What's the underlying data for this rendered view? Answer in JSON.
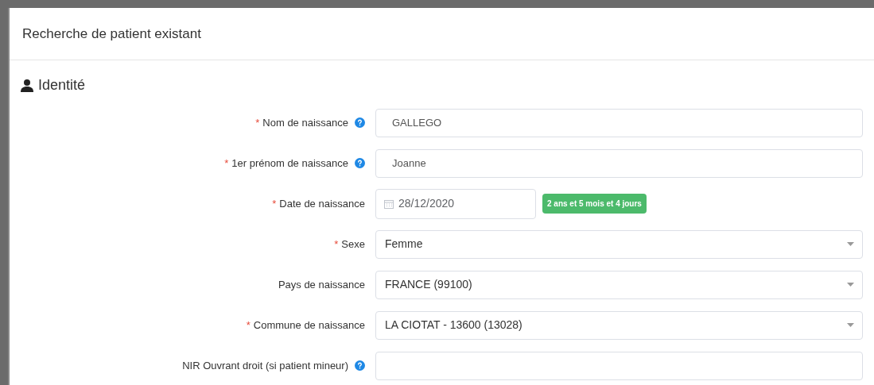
{
  "modal": {
    "title": "Recherche de patient existant"
  },
  "section": {
    "title": "Identité"
  },
  "fields": [
    {
      "kind": "text",
      "required_mark": "*",
      "label": "Nom de naissance",
      "help": true,
      "value": "GALLEGO"
    },
    {
      "kind": "text",
      "required_mark": "*",
      "label": "1er prénom de naissance",
      "help": true,
      "value": "Joanne"
    },
    {
      "kind": "date",
      "required_mark": "*",
      "label": "Date de naissance",
      "help": false,
      "value": "28/12/2020",
      "badge": "2 ans et 5 mois et 4 jours"
    },
    {
      "kind": "select",
      "required_mark": "*",
      "label": "Sexe",
      "help": false,
      "value": "Femme"
    },
    {
      "kind": "select",
      "label": "Pays de naissance",
      "help": false,
      "value": "FRANCE (99100)"
    },
    {
      "kind": "select",
      "required_mark": "*",
      "label": "Commune de naissance",
      "help": false,
      "value": "LA CIOTAT - 13600 (13028)"
    },
    {
      "kind": "text",
      "label": "NIR Ouvrant droit (si patient mineur)",
      "help": true
    }
  ]
}
